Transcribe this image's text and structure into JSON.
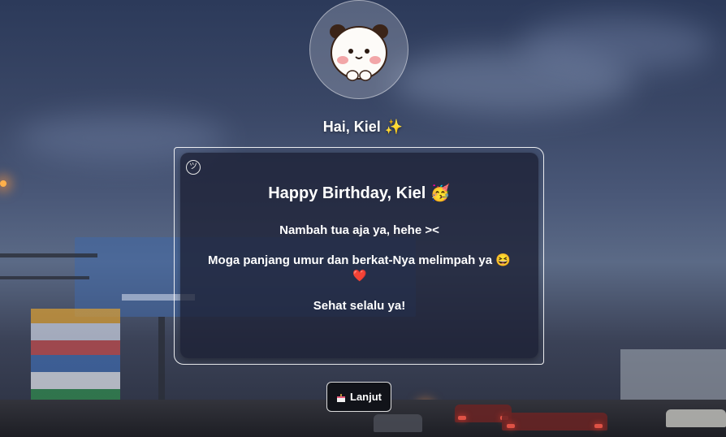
{
  "header": {
    "greeting": "Hai, Kiel ✨"
  },
  "card": {
    "title": "Happy Birthday, Kiel 🥳",
    "corner_icon": "smile-icon",
    "line1": "Nambah tua aja ya, hehe ><",
    "line2": "Moga panjang umur dan berkat-Nya melimpah ya 😆",
    "heart": "❤️",
    "line3": "Sehat selalu ya!"
  },
  "next_button": {
    "label": "Lanjut",
    "icon": "cake-icon"
  },
  "colors": {
    "card_bg": "#1c2034",
    "button_bg": "#111319",
    "heart": "#e02a3a"
  }
}
